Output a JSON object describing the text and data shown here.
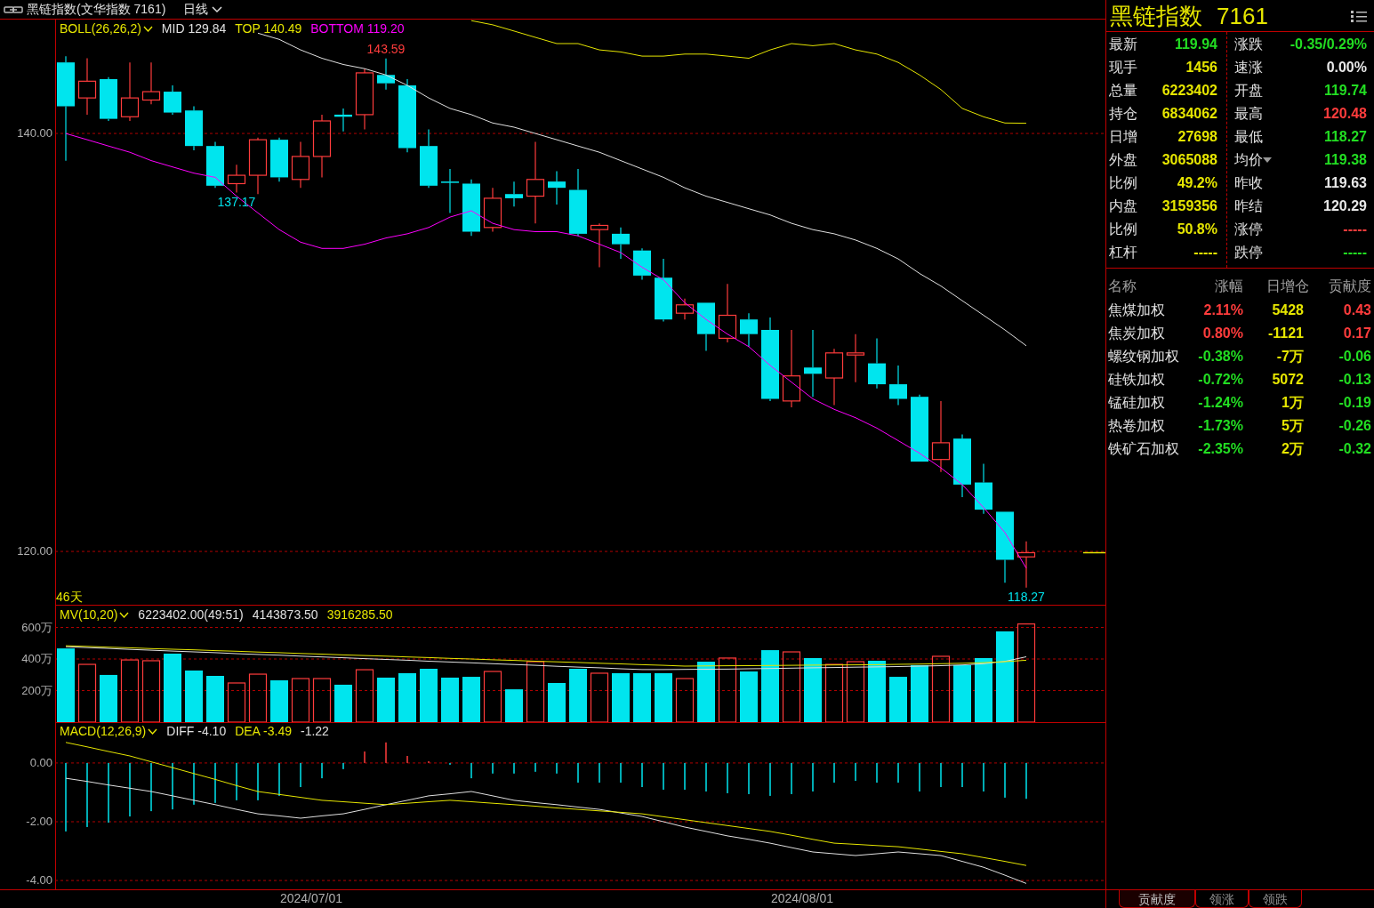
{
  "header": {
    "title": "黑链指数(文华指数 7161)",
    "period": "日线"
  },
  "price_panel": {
    "indicator": "BOLL(26,26,2)",
    "readouts": [
      "129.84",
      "140.49",
      "119.20"
    ],
    "days": "46天",
    "extreme_labels": [
      {
        "kind": "high",
        "text": "143.59",
        "color": "#ff3c3c"
      },
      {
        "kind": "low",
        "text": "137.17",
        "color": "#00e5ee"
      },
      {
        "kind": "low",
        "text": "118.27",
        "color": "#00e5ee"
      }
    ],
    "chart_data": {
      "type": "line",
      "grid": true,
      "ylim": [
        117.45,
        145.45
      ],
      "yticks": [
        {
          "value": 120,
          "label": "120.00"
        },
        {
          "value": 140,
          "label": "140.00"
        }
      ],
      "series": [
        {
          "name": "MID",
          "color": "#e0e0e0",
          "values": [
            null,
            null,
            null,
            null,
            null,
            null,
            null,
            null,
            null,
            144.8,
            144.5,
            144.0,
            143.6,
            143.3,
            143.1,
            142.8,
            142.3,
            141.7,
            141.2,
            140.9,
            140.5,
            140.3,
            140.0,
            139.7,
            139.4,
            139.1,
            138.7,
            138.3,
            137.9,
            137.4,
            137.0,
            136.7,
            136.4,
            136.1,
            135.7,
            135.4,
            135.2,
            134.9,
            134.5,
            134.0,
            133.3,
            132.7,
            132.0,
            131.3,
            130.6,
            129.84
          ]
        },
        {
          "name": "TOP",
          "color": "#e6e600",
          "values": [
            null,
            null,
            null,
            null,
            null,
            null,
            null,
            null,
            null,
            null,
            null,
            null,
            null,
            null,
            null,
            null,
            null,
            null,
            null,
            145.4,
            145.2,
            144.9,
            144.6,
            144.3,
            144.3,
            144.0,
            143.9,
            143.7,
            143.7,
            143.8,
            143.8,
            143.7,
            143.6,
            144.0,
            144.3,
            144.2,
            144.3,
            144.0,
            143.8,
            143.4,
            142.8,
            142.1,
            141.2,
            140.8,
            140.5,
            140.49
          ]
        },
        {
          "name": "BOTTOM",
          "color": "#ff00ff",
          "values": [
            140.0,
            139.7,
            139.4,
            139.1,
            138.7,
            138.4,
            138.1,
            137.9,
            137.0,
            136.2,
            135.4,
            134.8,
            134.5,
            134.5,
            134.7,
            135.0,
            135.2,
            135.5,
            136.0,
            136.3,
            135.7,
            135.4,
            135.3,
            135.3,
            135.1,
            134.7,
            134.3,
            133.6,
            133.0,
            131.9,
            131.1,
            130.4,
            129.8,
            128.9,
            128.1,
            127.3,
            126.8,
            126.4,
            125.9,
            125.3,
            124.7,
            124.0,
            123.2,
            122.1,
            120.9,
            119.2
          ]
        }
      ]
    }
  },
  "volume_panel": {
    "indicator": "MV(10,20)",
    "readouts": [
      "6223402.00(49:51)",
      "4143873.50",
      "3916285.50"
    ],
    "chart_data": {
      "type": "bar",
      "grid": true,
      "ylim": [
        0,
        743.7
      ],
      "yticks": [
        {
          "value": 200,
          "label": "200万"
        },
        {
          "value": 400,
          "label": "400万"
        },
        {
          "value": 600,
          "label": "600万"
        }
      ],
      "series": [
        {
          "type": "bar",
          "colors": [
            "#00e5ee",
            "#ff3c3c",
            "#00e5ee",
            "#ff3c3c",
            "#ff3c3c",
            "#00e5ee",
            "#00e5ee",
            "#00e5ee",
            "#ff3c3c",
            "#ff3c3c",
            "#00e5ee",
            "#ff3c3c",
            "#ff3c3c",
            "#00e5ee",
            "#ff3c3c",
            "#00e5ee",
            "#00e5ee",
            "#00e5ee",
            "#00e5ee",
            "#00e5ee",
            "#ff3c3c",
            "#00e5ee",
            "#ff3c3c",
            "#00e5ee",
            "#00e5ee",
            "#ff3c3c",
            "#00e5ee",
            "#00e5ee",
            "#00e5ee",
            "#ff3c3c",
            "#00e5ee",
            "#ff3c3c",
            "#00e5ee",
            "#00e5ee",
            "#ff3c3c",
            "#00e5ee",
            "#ff3c3c",
            "#ff3c3c",
            "#00e5ee",
            "#00e5ee",
            "#00e5ee",
            "#ff3c3c",
            "#00e5ee",
            "#00e5ee",
            "#00e5ee",
            "#ff3c3c"
          ],
          "values": [
            467,
            366,
            299,
            394,
            389,
            434,
            327,
            293,
            248,
            304,
            265,
            276,
            276,
            237,
            332,
            282,
            310,
            338,
            282,
            287,
            321,
            208,
            383,
            248,
            338,
            310,
            310,
            310,
            310,
            276,
            383,
            406,
            321,
            456,
            445,
            406,
            366,
            383,
            389,
            287,
            361,
            417,
            361,
            406,
            575,
            622
          ]
        },
        {
          "type": "line",
          "color": "#e0e0e0",
          "values": [
            478,
            472,
            467,
            461,
            456,
            450,
            445,
            440,
            434,
            429,
            424,
            418,
            413,
            408,
            402,
            397,
            392,
            386,
            381,
            376,
            370,
            365,
            360,
            354,
            349,
            344,
            338,
            333,
            333,
            334,
            335,
            336,
            338,
            340,
            342,
            344,
            346,
            348,
            350,
            352,
            355,
            358,
            362,
            370,
            385,
            414
          ]
        },
        {
          "type": "line",
          "color": "#e6e600",
          "values": [
            484,
            480,
            475,
            471,
            466,
            462,
            458,
            453,
            449,
            444,
            440,
            435,
            431,
            426,
            422,
            418,
            413,
            409,
            404,
            400,
            395,
            391,
            386,
            382,
            378,
            373,
            369,
            364,
            360,
            355,
            356,
            357,
            358,
            359,
            360,
            361,
            362,
            363,
            364,
            366,
            368,
            370,
            373,
            377,
            383,
            392
          ]
        }
      ]
    }
  },
  "macd_panel": {
    "indicator": "MACD(12,26,9)",
    "readouts": [
      "-4.10",
      "-3.49",
      "-1.22"
    ],
    "chart_data": {
      "type": "line",
      "grid": true,
      "ylim": [
        -4.3,
        1.39
      ],
      "yticks": [
        {
          "value": 0,
          "label": "0.00"
        },
        {
          "value": -2,
          "label": "-2.00"
        },
        {
          "value": -4,
          "label": "-4.00"
        }
      ],
      "series": [
        {
          "name": "DIFF",
          "type": "line",
          "color": "#e0e0e0",
          "values": [
            -0.52,
            -0.63,
            -0.75,
            -0.86,
            -0.97,
            -1.12,
            -1.27,
            -1.42,
            -1.58,
            -1.73,
            -1.8,
            -1.88,
            -1.8,
            -1.73,
            -1.58,
            -1.42,
            -1.27,
            -1.12,
            -1.05,
            -0.97,
            -1.12,
            -1.27,
            -1.35,
            -1.42,
            -1.5,
            -1.58,
            -1.7,
            -1.82,
            -2.0,
            -2.18,
            -2.33,
            -2.48,
            -2.6,
            -2.73,
            -2.88,
            -3.03,
            -3.09,
            -3.15,
            -3.09,
            -3.03,
            -3.09,
            -3.15,
            -3.35,
            -3.55,
            -3.82,
            -4.1
          ]
        },
        {
          "name": "DEA",
          "type": "line",
          "color": "#e6e600",
          "values": [
            0.7,
            0.55,
            0.39,
            0.24,
            0.04,
            -0.16,
            -0.36,
            -0.56,
            -0.77,
            -0.97,
            -1.07,
            -1.17,
            -1.27,
            -1.32,
            -1.37,
            -1.42,
            -1.37,
            -1.32,
            -1.27,
            -1.32,
            -1.37,
            -1.42,
            -1.47,
            -1.53,
            -1.58,
            -1.63,
            -1.68,
            -1.73,
            -1.83,
            -1.93,
            -2.03,
            -2.13,
            -2.23,
            -2.33,
            -2.46,
            -2.6,
            -2.73,
            -2.77,
            -2.81,
            -2.85,
            -2.93,
            -3.01,
            -3.09,
            -3.22,
            -3.35,
            -3.49
          ]
        },
        {
          "type": "bar",
          "colors": [
            "#00e5ee",
            "#00e5ee",
            "#00e5ee",
            "#00e5ee",
            "#00e5ee",
            "#00e5ee",
            "#00e5ee",
            "#00e5ee",
            "#00e5ee",
            "#00e5ee",
            "#00e5ee",
            "#00e5ee",
            "#00e5ee",
            "#00e5ee",
            "#ff3c3c",
            "#ff3c3c",
            "#ff3c3c",
            "#ff3c3c",
            "#00e5ee",
            "#00e5ee",
            "#00e5ee",
            "#00e5ee",
            "#00e5ee",
            "#00e5ee",
            "#00e5ee",
            "#00e5ee",
            "#00e5ee",
            "#00e5ee",
            "#00e5ee",
            "#00e5ee",
            "#00e5ee",
            "#00e5ee",
            "#00e5ee",
            "#00e5ee",
            "#00e5ee",
            "#00e5ee",
            "#00e5ee",
            "#00e5ee",
            "#00e5ee",
            "#00e5ee",
            "#00e5ee",
            "#00e5ee",
            "#00e5ee",
            "#00e5ee",
            "#00e5ee",
            "#00e5ee"
          ],
          "values": [
            -2.33,
            -2.18,
            -2.03,
            -1.82,
            -1.64,
            -1.58,
            -1.42,
            -1.36,
            -1.27,
            -1.27,
            -1.12,
            -0.82,
            -0.52,
            -0.21,
            0.39,
            0.7,
            0.24,
            0.06,
            -0.06,
            -0.52,
            -0.36,
            -0.36,
            -0.3,
            -0.36,
            -0.67,
            -0.67,
            -0.67,
            -0.82,
            -0.91,
            -0.91,
            -0.97,
            -1.03,
            -1.06,
            -1.12,
            -1.06,
            -0.97,
            -0.67,
            -0.61,
            -0.67,
            -0.67,
            -0.97,
            -0.82,
            -0.82,
            -0.97,
            -1.18,
            -1.22
          ]
        }
      ]
    }
  },
  "date_labels": [
    "2024/07/01",
    "2024/08/01"
  ],
  "quote": {
    "name": "黑链指数",
    "code": "7161",
    "left": [
      {
        "label": "最新",
        "value": "119.94",
        "color": "#22dd22"
      },
      {
        "label": "现手",
        "value": "1456",
        "color": "#e6e600"
      },
      {
        "label": "总量",
        "value": "6223402",
        "color": "#e6e600"
      },
      {
        "label": "持仓",
        "value": "6834062",
        "color": "#e6e600"
      },
      {
        "label": "日增",
        "value": "27698",
        "color": "#e6e600"
      },
      {
        "label": "外盘",
        "value": "3065088",
        "color": "#e6e600"
      },
      {
        "label": "比例",
        "value": "49.2%",
        "color": "#e6e600"
      },
      {
        "label": "内盘",
        "value": "3159356",
        "color": "#e6e600"
      },
      {
        "label": "比例",
        "value": "50.8%",
        "color": "#e6e600"
      },
      {
        "label": "杠杆",
        "value": "-----",
        "color": "#e6e600"
      }
    ],
    "right": [
      {
        "label": "涨跌",
        "value": "-0.35/0.29%",
        "color": "#22dd22",
        "menu": false
      },
      {
        "label": "速涨",
        "value": "0.00%",
        "color": "#e8e8e8",
        "menu": false
      },
      {
        "label": "开盘",
        "value": "119.74",
        "color": "#22dd22",
        "menu": false
      },
      {
        "label": "最高",
        "value": "120.48",
        "color": "#ff3c3c",
        "menu": false
      },
      {
        "label": "最低",
        "value": "118.27",
        "color": "#22dd22",
        "menu": false
      },
      {
        "label": "均价",
        "value": "119.38",
        "color": "#22dd22",
        "menu": true
      },
      {
        "label": "昨收",
        "value": "119.63",
        "color": "#e8e8e8",
        "menu": false
      },
      {
        "label": "昨结",
        "value": "120.29",
        "color": "#e8e8e8",
        "menu": false
      },
      {
        "label": "涨停",
        "value": "-----",
        "color": "#ff3c3c",
        "menu": false
      },
      {
        "label": "跌停",
        "value": "-----",
        "color": "#22dd22",
        "menu": false
      }
    ]
  },
  "components": {
    "columns": [
      "名称",
      "涨幅",
      "日增仓",
      "贡献度"
    ],
    "rows": [
      {
        "name": "焦煤加权",
        "change": "2.11%",
        "oi_change": "5428",
        "contribution": "0.43",
        "color": "#ff3c3c"
      },
      {
        "name": "焦炭加权",
        "change": "0.80%",
        "oi_change": "-1121",
        "contribution": "0.17",
        "color": "#ff3c3c"
      },
      {
        "name": "螺纹钢加权",
        "change": "-0.38%",
        "oi_change": "-7万",
        "contribution": "-0.06",
        "color": "#22dd22"
      },
      {
        "name": "硅铁加权",
        "change": "-0.72%",
        "oi_change": "5072",
        "contribution": "-0.13",
        "color": "#22dd22"
      },
      {
        "name": "锰硅加权",
        "change": "-1.24%",
        "oi_change": "1万",
        "contribution": "-0.19",
        "color": "#22dd22"
      },
      {
        "name": "热卷加权",
        "change": "-1.73%",
        "oi_change": "5万",
        "contribution": "-0.26",
        "color": "#22dd22"
      },
      {
        "name": "铁矿石加权",
        "change": "-2.35%",
        "oi_change": "2万",
        "contribution": "-0.32",
        "color": "#22dd22"
      }
    ]
  },
  "tabs": [
    {
      "label": "贡献度",
      "selected": true
    },
    {
      "label": "领涨",
      "selected": false
    },
    {
      "label": "领跌",
      "selected": false
    }
  ]
}
